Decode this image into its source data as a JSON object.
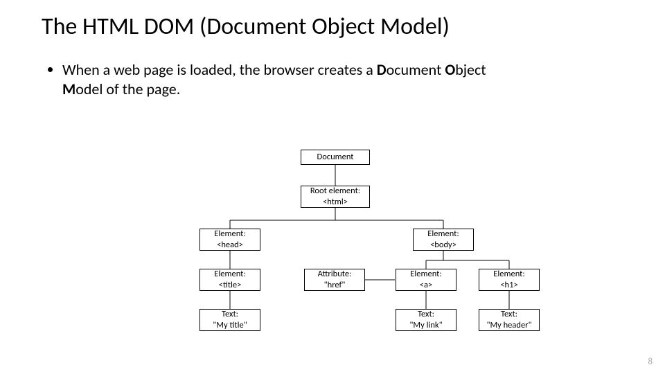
{
  "title": "The HTML DOM (Document Object Model)",
  "bullet_prefix": "When a web page is loaded, the browser creates a ",
  "bullet_bold": "D",
  "bullet_mid1": "ocument ",
  "bullet_bold2": "O",
  "bullet_mid2": "bject ",
  "bullet_bold3": "M",
  "bullet_suffix": "odel of the page.",
  "page_number": "8",
  "nodes": {
    "document": {
      "l1": "Document"
    },
    "root": {
      "l1": "Root element:",
      "l2": "<html>"
    },
    "head": {
      "l1": "Element:",
      "l2": "<head>"
    },
    "body": {
      "l1": "Element:",
      "l2": "<body>"
    },
    "title_el": {
      "l1": "Element:",
      "l2": "<title>"
    },
    "href": {
      "l1": "Attribute:",
      "l2": "\"href\""
    },
    "a_el": {
      "l1": "Element:",
      "l2": "<a>"
    },
    "h1_el": {
      "l1": "Element:",
      "l2": "<h1>"
    },
    "text_title": {
      "l1": "Text:",
      "l2": "\"My title\""
    },
    "text_link": {
      "l1": "Text:",
      "l2": "\"My link\""
    },
    "text_header": {
      "l1": "Text:",
      "l2": "\"My header\""
    }
  }
}
